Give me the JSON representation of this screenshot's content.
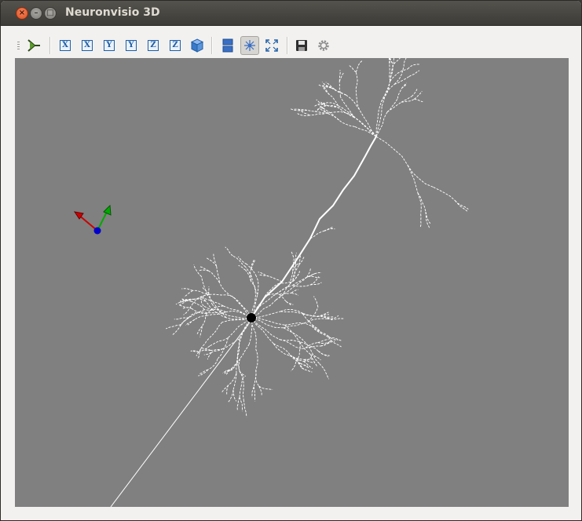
{
  "window": {
    "title": "Neuronvisio 3D"
  },
  "window_buttons": {
    "close": "×",
    "minimize": "–",
    "maximize": "□"
  },
  "toolbar": {
    "buttons": [
      {
        "icon": "neuron-logo-icon"
      },
      {
        "icon": "view-x-icon",
        "label": "X"
      },
      {
        "icon": "view-x-reverse-icon",
        "label": "X"
      },
      {
        "icon": "view-y-icon",
        "label": "Y"
      },
      {
        "icon": "view-y-reverse-icon",
        "label": "Y"
      },
      {
        "icon": "view-z-icon",
        "label": "Z"
      },
      {
        "icon": "view-z-reverse-icon",
        "label": "Z"
      },
      {
        "icon": "isometric-cube-icon"
      },
      {
        "icon": "toggle-panel-icon"
      },
      {
        "icon": "interact-mode-icon",
        "active": true
      },
      {
        "icon": "fit-all-icon"
      },
      {
        "icon": "save-icon"
      },
      {
        "icon": "settings-icon"
      }
    ]
  },
  "viewport": {
    "background": "#808080",
    "neuron_color": "#ffffff",
    "soma_color": "#000000",
    "axes_colors": {
      "x": "#cc0000",
      "y": "#00aa00",
      "z": "#0000cc"
    }
  }
}
